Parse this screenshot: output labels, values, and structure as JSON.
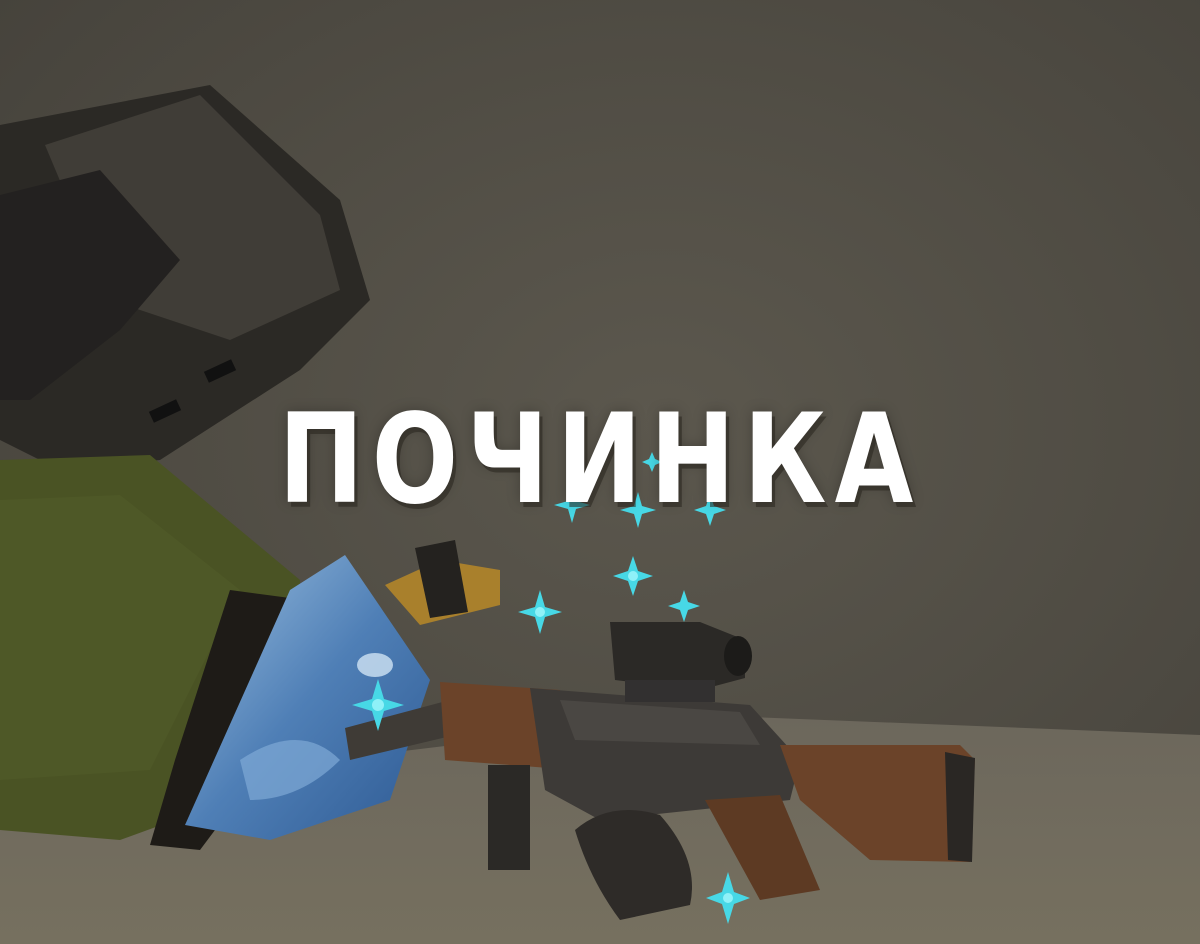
{
  "title": "ПОЧИНКА",
  "colors": {
    "background": "#57534a",
    "floor": "#6f6a5f",
    "sleeve": "#4a5324",
    "glove": "#1e1b17",
    "helmet": "#3a3833",
    "spray_bottle": "#5d8cc0",
    "wood": "#6b4329",
    "metal": "#3b3835",
    "sparkle": "#47d8e6",
    "title_text": "#ffffff"
  },
  "objects": {
    "character": "blocky-soldier",
    "tool": "spray-bottle",
    "weapon": "rifle-with-scope",
    "effect": "repair-sparkles"
  }
}
